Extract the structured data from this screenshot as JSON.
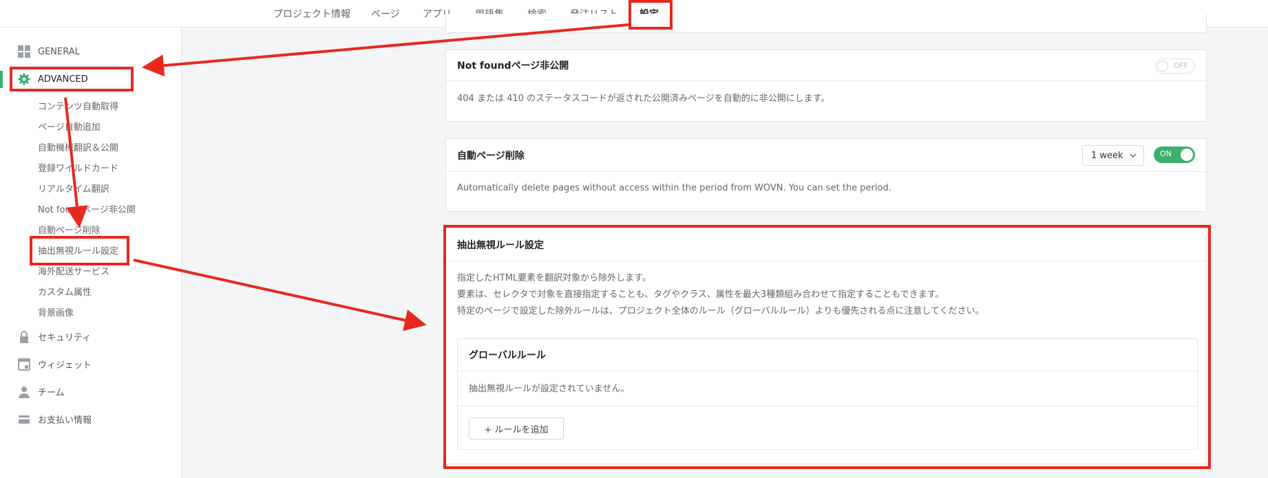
{
  "topnav": {
    "tabs": [
      {
        "label": "プロジェクト情報"
      },
      {
        "label": "ページ"
      },
      {
        "label": "アプリ"
      },
      {
        "label": "用語集"
      },
      {
        "label": "検索"
      },
      {
        "label": "発注リスト"
      },
      {
        "label": "設定",
        "active": true
      }
    ]
  },
  "sidebar": {
    "general": "GENERAL",
    "advanced": "ADVANCED",
    "advanced_items": [
      "コンテンツ自動取得",
      "ページ自動追加",
      "自動機械翻訳＆公開",
      "登録ワイルドカード",
      "リアルタイム翻訳",
      "Not foundページ非公開",
      "自動ページ削除",
      "抽出無視ルール設定",
      "海外配送サービス",
      "カスタム属性",
      "背景画像"
    ],
    "security": "セキュリティ",
    "widget": "ウィジェット",
    "team": "チーム",
    "payment": "お支払い情報"
  },
  "cards": {
    "notfound": {
      "title": "Not foundページ非公開",
      "toggle": "OFF",
      "desc": "404 または 410 のステータスコードが返された公開済みページを自動的に非公開にします。"
    },
    "autodelete": {
      "title": "自動ページ削除",
      "select": "1 week",
      "toggle": "ON",
      "desc": "Automatically delete pages without access within the period from WOVN. You can set the period."
    },
    "ignore": {
      "title": "抽出無視ルール設定",
      "lines": [
        "指定したHTML要素を翻訳対象から除外します。",
        "要素は、セレクタで対象を直接指定することも、タグやクラス、属性を最大3種類組み合わせて指定することもできます。",
        "特定のページで設定した除外ルールは、プロジェクト全体のルール（グローバルルール）よりも優先される点に注意してください。"
      ],
      "global_title": "グローバルルール",
      "empty": "抽出無視ルールが設定されていません。",
      "add_button": "+ ルールを追加"
    }
  },
  "colors": {
    "accent": "#3ab16c",
    "annotation": "#e8281e"
  }
}
